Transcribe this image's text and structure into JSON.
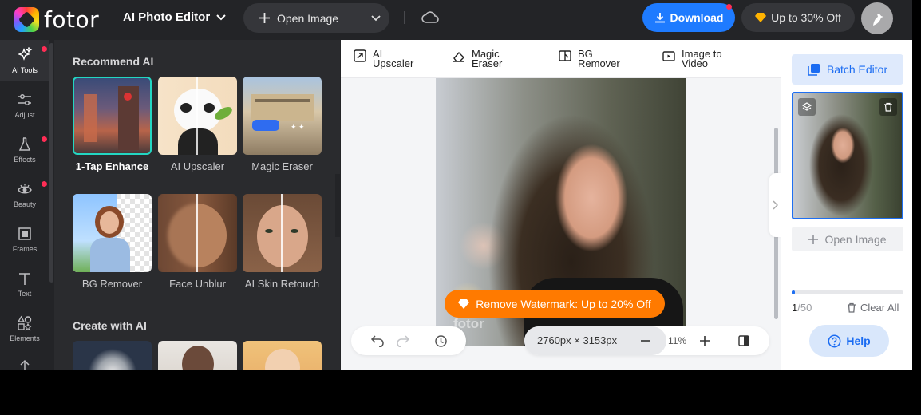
{
  "brand": {
    "name": "fotor"
  },
  "header": {
    "app_title": "AI Photo Editor",
    "open_image": "Open Image",
    "download": "Download",
    "promo": "Up to 30% Off"
  },
  "leftnav": {
    "items": [
      {
        "label": "AI Tools",
        "icon": "sparkle-icon",
        "active": true,
        "dot": true
      },
      {
        "label": "Adjust",
        "icon": "sliders-icon",
        "dot": false
      },
      {
        "label": "Effects",
        "icon": "flask-icon",
        "dot": true
      },
      {
        "label": "Beauty",
        "icon": "eye-icon",
        "dot": true
      },
      {
        "label": "Frames",
        "icon": "frame-icon",
        "dot": false
      },
      {
        "label": "Text",
        "icon": "text-icon",
        "dot": false
      },
      {
        "label": "Elements",
        "icon": "shapes-icon",
        "dot": false
      }
    ]
  },
  "panel": {
    "recommend_title": "Recommend AI",
    "recommend": [
      {
        "label": "1-Tap Enhance",
        "selected": true
      },
      {
        "label": "AI Upscaler"
      },
      {
        "label": "Magic Eraser"
      },
      {
        "label": "BG Remover"
      },
      {
        "label": "Face Unblur"
      },
      {
        "label": "AI Skin Retouch"
      }
    ],
    "create_title": "Create with AI"
  },
  "quick_tools": [
    {
      "line1": "AI",
      "line2": "Upscaler",
      "icon": "upscale-icon"
    },
    {
      "line1": "Magic",
      "line2": "Eraser",
      "icon": "eraser-icon"
    },
    {
      "line1": "BG",
      "line2": "Remover",
      "icon": "bg-remove-icon"
    },
    {
      "line1": "Image to",
      "line2": "Video",
      "icon": "video-icon"
    }
  ],
  "canvas": {
    "watermark_cta": "Remove Watermark: Up to 20% Off",
    "watermark_text": "fotor",
    "dimensions": "2760px × 3153px",
    "zoom": "11%"
  },
  "right": {
    "batch_editor": "Batch Editor",
    "open_image": "Open Image",
    "count_current": "1",
    "count_total": "/50",
    "progress": 0.02,
    "clear_all": "Clear All",
    "help": "Help"
  },
  "colors": {
    "accent": "#1e7bff",
    "selected_border": "#23d6c2",
    "watermark_orange": "#ff7a00",
    "notify_dot": "#ff2d55"
  }
}
